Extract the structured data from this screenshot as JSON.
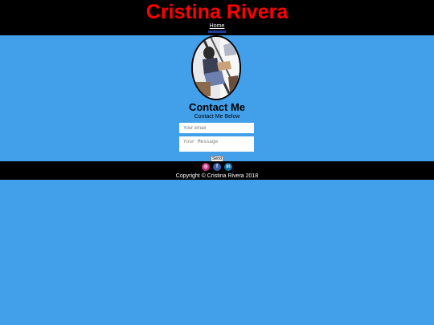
{
  "header": {
    "title": "Cristina Rivera",
    "nav": [
      {
        "label": "Home",
        "active": true
      }
    ]
  },
  "profile": {
    "photo_icon": "profile-photo"
  },
  "contact": {
    "title": "Contact Me",
    "subtitle": "Contact Me Below",
    "email_placeholder": "Your email",
    "message_placeholder": "Your Message",
    "send_label": "Send"
  },
  "footer": {
    "social": [
      {
        "name": "instagram-icon",
        "glyph": "◎"
      },
      {
        "name": "facebook-icon",
        "glyph": "f"
      },
      {
        "name": "linkedin-icon",
        "glyph": "in"
      }
    ],
    "copyright": "Copyright © Cristina Rivera 2018"
  },
  "colors": {
    "page_background": "#42a0ea",
    "bar_background": "#000000",
    "title_color": "#ff0000"
  }
}
